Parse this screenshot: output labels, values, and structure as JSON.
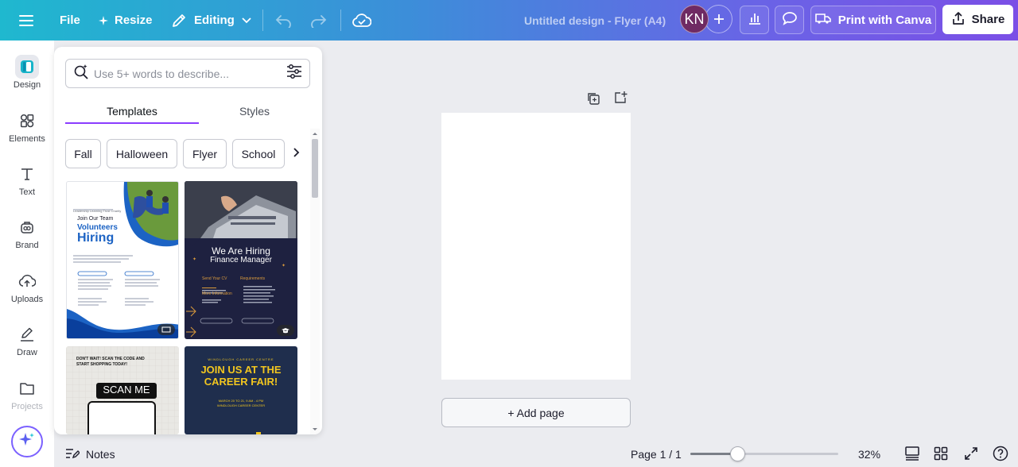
{
  "topbar": {
    "file_label": "File",
    "resize_label": "Resize",
    "editing_label": "Editing",
    "doc_title": "Untitled design - Flyer (A4)",
    "avatar_initials": "KN",
    "print_label": "Print with Canva",
    "share_label": "Share"
  },
  "rail": {
    "items": [
      {
        "label": "Design",
        "icon": "design-icon"
      },
      {
        "label": "Elements",
        "icon": "elements-icon"
      },
      {
        "label": "Text",
        "icon": "text-icon"
      },
      {
        "label": "Brand",
        "icon": "brand-icon"
      },
      {
        "label": "Uploads",
        "icon": "uploads-icon"
      },
      {
        "label": "Draw",
        "icon": "draw-icon"
      },
      {
        "label": "Projects",
        "icon": "projects-icon"
      }
    ]
  },
  "panel": {
    "search_placeholder": "Use 5+ words to describe...",
    "tabs": [
      {
        "label": "Templates"
      },
      {
        "label": "Styles"
      }
    ],
    "chips": [
      {
        "label": "Fall"
      },
      {
        "label": "Halloween"
      },
      {
        "label": "Flyer"
      },
      {
        "label": "School"
      }
    ],
    "templates": [
      {
        "name": "volunteer-hiring",
        "top_line": "Leadership Learning Trust Charity",
        "heading_small": "Join Our Team",
        "heading_blue": "Volunteers",
        "heading_big": "Hiring"
      },
      {
        "name": "finance-hiring",
        "heading": "We Are Hiring",
        "subheading": "Finance Manager",
        "left_col": "Send Your CV",
        "right_col": "Requirements",
        "more_info": "More Information"
      },
      {
        "name": "scan-me",
        "top_text": "DON'T WAIT! SCAN THE CODE AND START SHOPPING TODAY!",
        "scan_label": "SCAN ME"
      },
      {
        "name": "career-fair",
        "top_text": "WINDLOUGH CAREER CENTRE",
        "heading": "JOIN US AT THE CAREER FAIR!",
        "date_text": "MARCH 20 TO 21, 9 AM - 4 PM",
        "venue_text": "WINDLOUGH CAREER CENTER"
      }
    ]
  },
  "canvas": {
    "add_page_label": "+ Add page"
  },
  "bottombar": {
    "notes_label": "Notes",
    "page_indicator": "Page 1 / 1",
    "zoom_value": "32%",
    "zoom_fraction": 0.32
  },
  "colors": {
    "accent": "#8b3dff",
    "topbar_start": "#1fb8cf",
    "topbar_end": "#7b4fe6",
    "avatar": "#6f2a63"
  }
}
